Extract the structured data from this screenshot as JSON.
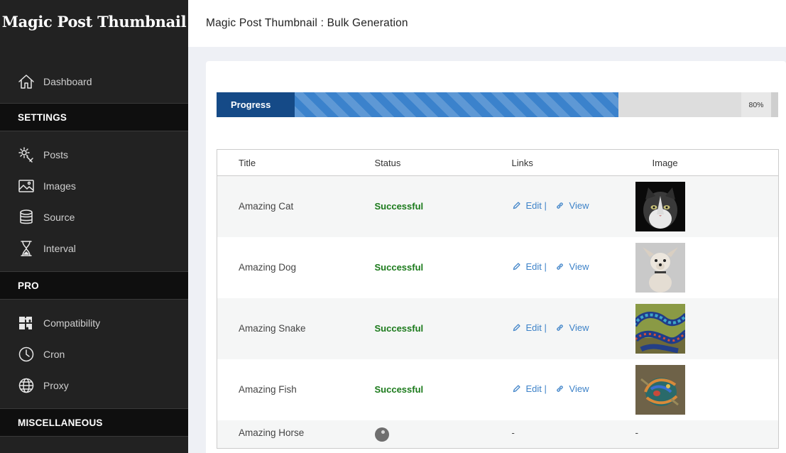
{
  "sidebar": {
    "logo": "Magic Post Thumbnail",
    "dashboard": "Dashboard",
    "sections": {
      "settings": "SETTINGS",
      "pro": "PRO",
      "misc": "MISCELLANEOUS"
    },
    "settings_items": [
      "Posts",
      "Images",
      "Source",
      "Interval"
    ],
    "pro_items": [
      "Compatibility",
      "Cron",
      "Proxy"
    ]
  },
  "header": {
    "title": "Magic Post Thumbnail : Bulk Generation"
  },
  "progress": {
    "label": "Progress",
    "percent_text": "80%",
    "value": 0.8
  },
  "table": {
    "columns": [
      "Title",
      "Status",
      "Links",
      "Image"
    ],
    "edit_label": "Edit |",
    "view_label": "View",
    "rows": [
      {
        "title": "Amazing Cat",
        "status": "Successful"
      },
      {
        "title": "Amazing Dog",
        "status": "Successful"
      },
      {
        "title": "Amazing Snake",
        "status": "Successful"
      },
      {
        "title": "Amazing Fish",
        "status": "Successful"
      },
      {
        "title": "Amazing Horse",
        "links": "-",
        "image": "-"
      }
    ]
  },
  "colors": {
    "sidebar_bg": "#222222",
    "section_bg": "#0f0f0f",
    "progress_label_bg": "#154a87",
    "progress_bar": "#3b82cc",
    "success": "#1b7a1b",
    "link": "#3d82c8"
  },
  "icons": [
    "home-icon",
    "gear-wrench-icon",
    "image-icon",
    "database-icon",
    "hourglass-icon",
    "puzzle-icon",
    "clock-icon",
    "globe-icon",
    "pencil-icon",
    "link-icon",
    "loading-spinner-icon"
  ]
}
